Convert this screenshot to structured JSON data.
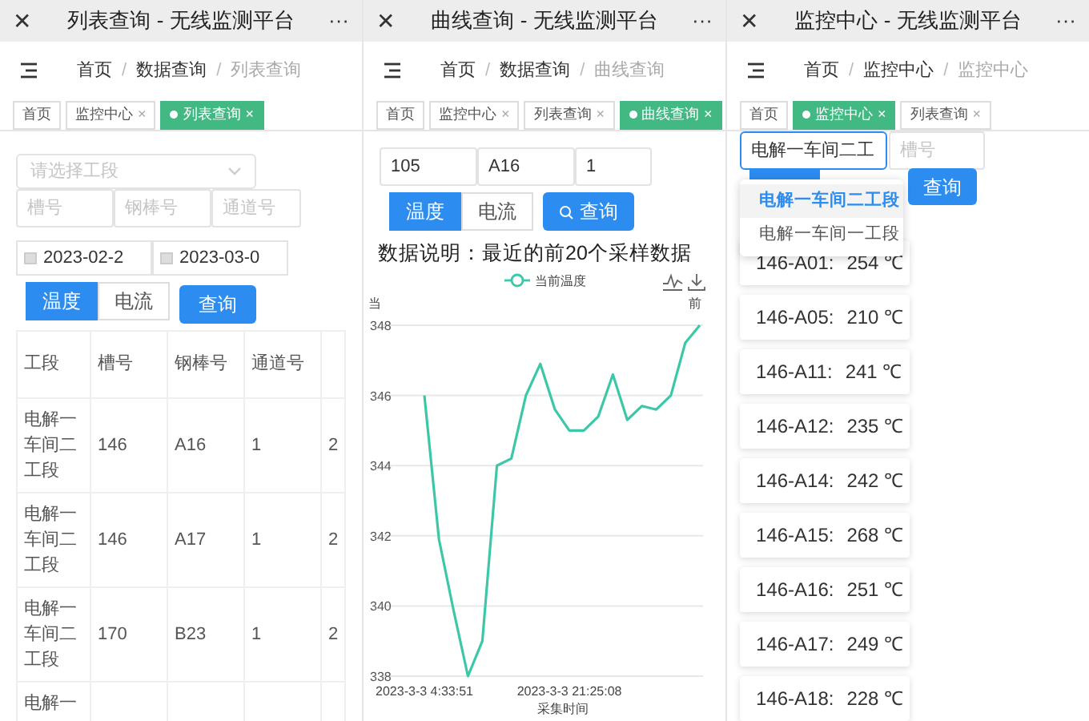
{
  "screens": [
    {
      "window": {
        "title": "列表查询 - 无线监测平台",
        "close": "✕",
        "more": "···"
      },
      "breadcrumb": [
        {
          "label": "首页",
          "current": false
        },
        {
          "label": "数据查询",
          "current": false
        },
        {
          "label": "列表查询",
          "current": true
        }
      ],
      "breadcrumb_sep": "/",
      "tabs": [
        {
          "label": "首页",
          "selected": false
        },
        {
          "label": "监控中心",
          "selected": false,
          "close": "×"
        },
        {
          "label": "列表查询",
          "selected": true,
          "close": "×"
        }
      ],
      "kind": "list",
      "select": {
        "placeholder": "请选择工段"
      },
      "inputs": [
        {
          "placeholder": "槽号"
        },
        {
          "placeholder": "钢棒号"
        },
        {
          "placeholder": "通道号"
        }
      ],
      "dates": [
        {
          "value": "2023-02-2"
        },
        {
          "value": "2023-03-0"
        }
      ],
      "toggle": [
        {
          "label": "温度",
          "selected": true
        },
        {
          "label": "电流",
          "selected": false
        }
      ],
      "query_button": "查询",
      "table": {
        "columns": [
          "工段",
          "槽号",
          "钢棒号",
          "通道号"
        ],
        "rows": [
          [
            "电解一车间二工段",
            "146",
            "A16",
            "1",
            "2"
          ],
          [
            "电解一车间二工段",
            "146",
            "A17",
            "1",
            "2"
          ],
          [
            "电解一车间二工段",
            "170",
            "B23",
            "1",
            "2"
          ],
          [
            "电解一"
          ]
        ]
      }
    },
    {
      "window": {
        "title": "曲线查询 - 无线监测平台",
        "close": "✕",
        "more": "···"
      },
      "breadcrumb": [
        {
          "label": "首页",
          "current": false
        },
        {
          "label": "数据查询",
          "current": false
        },
        {
          "label": "曲线查询",
          "current": true
        }
      ],
      "breadcrumb_sep": "/",
      "tabs": [
        {
          "label": "首页",
          "selected": false
        },
        {
          "label": "监控中心",
          "selected": false,
          "close": "×"
        },
        {
          "label": "列表查询",
          "selected": false,
          "close": "×"
        },
        {
          "label": "曲线查询",
          "selected": true,
          "close": "×"
        }
      ],
      "kind": "chart",
      "inputs": [
        {
          "value": "105"
        },
        {
          "value": "A16"
        },
        {
          "value": "1"
        }
      ],
      "toggle": [
        {
          "label": "温度",
          "selected": true
        },
        {
          "label": "电流",
          "selected": false
        }
      ],
      "query_button": "查询",
      "description": "数据说明：最近的前20个采样数据",
      "chart_data": {
        "type": "line",
        "xlabel": "采集时间",
        "ylim": [
          338,
          348
        ],
        "yticks": [
          338,
          340,
          342,
          344,
          346,
          348
        ],
        "grid": true,
        "categories": [
          "2023-3-3 4:33:51",
          null,
          null,
          null,
          null,
          null,
          null,
          null,
          null,
          null,
          "2023-3-3 21:25:08",
          null,
          null,
          null,
          null,
          null,
          null,
          null,
          null,
          null
        ],
        "series": [
          {
            "name": "当前温度",
            "color": "#3cc8a8",
            "values": [
              346,
              341.9,
              339.9,
              338,
              339,
              344,
              344.2,
              346,
              346.9,
              345.6,
              345,
              345,
              345.4,
              346.6,
              345.3,
              345.7,
              345.6,
              346,
              347.5,
              348
            ]
          }
        ]
      },
      "chart_corner_left": "当",
      "chart_corner_right": "前"
    },
    {
      "window": {
        "title": "监控中心 - 无线监测平台",
        "close": "✕",
        "more": "···"
      },
      "breadcrumb": [
        {
          "label": "首页",
          "current": false
        },
        {
          "label": "监控中心",
          "current": false
        },
        {
          "label": "监控中心",
          "current": true
        }
      ],
      "breadcrumb_sep": "/",
      "tabs": [
        {
          "label": "首页",
          "selected": false
        },
        {
          "label": "监控中心",
          "selected": true,
          "close": "×"
        },
        {
          "label": "列表查询",
          "selected": false,
          "close": "×"
        }
      ],
      "kind": "monitor",
      "select": {
        "value": "电解一车间二工",
        "expanded": true,
        "options": [
          {
            "label": "电解一车间二工段",
            "selected": true
          },
          {
            "label": "电解一车间一工段",
            "selected": false
          }
        ]
      },
      "inputs": [
        {
          "placeholder": "槽号"
        }
      ],
      "query_button": "查询",
      "cards": [
        {
          "name": "146-A01:",
          "value": "254 ℃"
        },
        {
          "name": "146-A05:",
          "value": "210 ℃"
        },
        {
          "name": "146-A11:",
          "value": "241 ℃"
        },
        {
          "name": "146-A12:",
          "value": "235 ℃"
        },
        {
          "name": "146-A14:",
          "value": "242 ℃"
        },
        {
          "name": "146-A15:",
          "value": "268 ℃"
        },
        {
          "name": "146-A16:",
          "value": "251 ℃"
        },
        {
          "name": "146-A17:",
          "value": "249 ℃"
        },
        {
          "name": "146-A18:",
          "value": "228 ℃"
        }
      ]
    }
  ]
}
